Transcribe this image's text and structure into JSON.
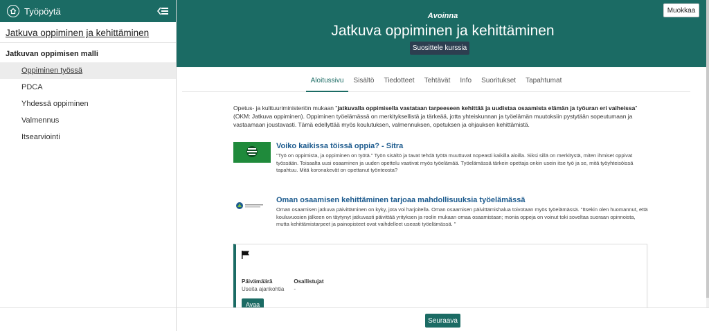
{
  "sidebar": {
    "header_title": "Työpöytä",
    "course_link": "Jatkuva oppiminen ja kehittäminen",
    "section_title": "Jatkuvan oppimisen malli",
    "items": [
      {
        "label": "Oppiminen työssä"
      },
      {
        "label": "PDCA"
      },
      {
        "label": "Yhdessä oppiminen"
      },
      {
        "label": "Valmennus"
      },
      {
        "label": "Itsearviointi"
      }
    ],
    "active_index": 0
  },
  "hero": {
    "status": "Avoinna",
    "title": "Jatkuva oppiminen ja kehittäminen",
    "recommend_label": "Suosittele kurssia",
    "edit_label": "Muokkaa"
  },
  "tabs": [
    {
      "label": "Aloitussivu"
    },
    {
      "label": "Sisältö"
    },
    {
      "label": "Tiedotteet"
    },
    {
      "label": "Tehtävät"
    },
    {
      "label": "Info"
    },
    {
      "label": "Suoritukset"
    },
    {
      "label": "Tapahtumat"
    }
  ],
  "active_tab": 0,
  "intro": {
    "prefix": "Opetus- ja kulttuuriministeriön mukaan \"",
    "bold": "jatkuvalla oppimisella vastataan tarpeeseen kehittää ja uudistaa osaamista elämän ja työuran eri vaiheissa",
    "suffix": "\" (OKM: Jatkuva oppiminen).  Oppiminen työelämässä on merkityksellistä ja tärkeää, jotta yhteiskunnan ja työelämän muutoksiin pystytään sopeutumaan ja vastaamaan joustavasti. Tämä edellyttää myös koulutuksen, valmennuksen, opetuksen ja ohjauksen kehittämistä."
  },
  "links": [
    {
      "title": "Voiko kaikissa töissä oppia? - Sitra",
      "description": "\"Työ on oppimista, ja oppiminen on työtä.\" Työn sisältö ja tavat tehdä työtä muuttuvat nopeasti kaikilla aloilla. Siksi sillä on merkitystä, miten ihmiset oppivat työssään. Toisaalta uusi osaaminen ja uuden opettelu vaativat myös työelämää. Työelämässä tärkein opettaja onkin usein itse työ ja se, mitä työyhteisöissä tapahtuu. Mitä koronakevät on opettanut työnteosta?"
    },
    {
      "title": "Oman osaamisen kehittäminen tarjoaa mahdollisuuksia työelämässä",
      "description": "Oman osaamisen jatkuva päivittäminen on kyky, jota voi harjoitella. Oman osaamisen päivittämishalua toivotaan myös työelämässä. \"Itsekin olen huomannut, että kouluvuosien jälkeen on täytynyt jatkuvasti päivittää yrityksen ja roolin mukaan omaa osaamistaan; monia oppeja on voinut toki soveltaa suoraan opinnoista, mutta kehittämistarpeet ja painopisteet ovat vaihdelleet useasti työelämässä. \""
    }
  ],
  "card": {
    "date_label": "Päivämäärä",
    "date_value": "Useita ajankohtia",
    "participants_label": "Osallistujat",
    "participants_value": "-",
    "open_label": "Avaa"
  },
  "footer": {
    "next_label": "Seuraava"
  },
  "colors": {
    "primary": "#1b6b64",
    "dark_button": "#2d3e50",
    "link": "#1d5b8e"
  }
}
